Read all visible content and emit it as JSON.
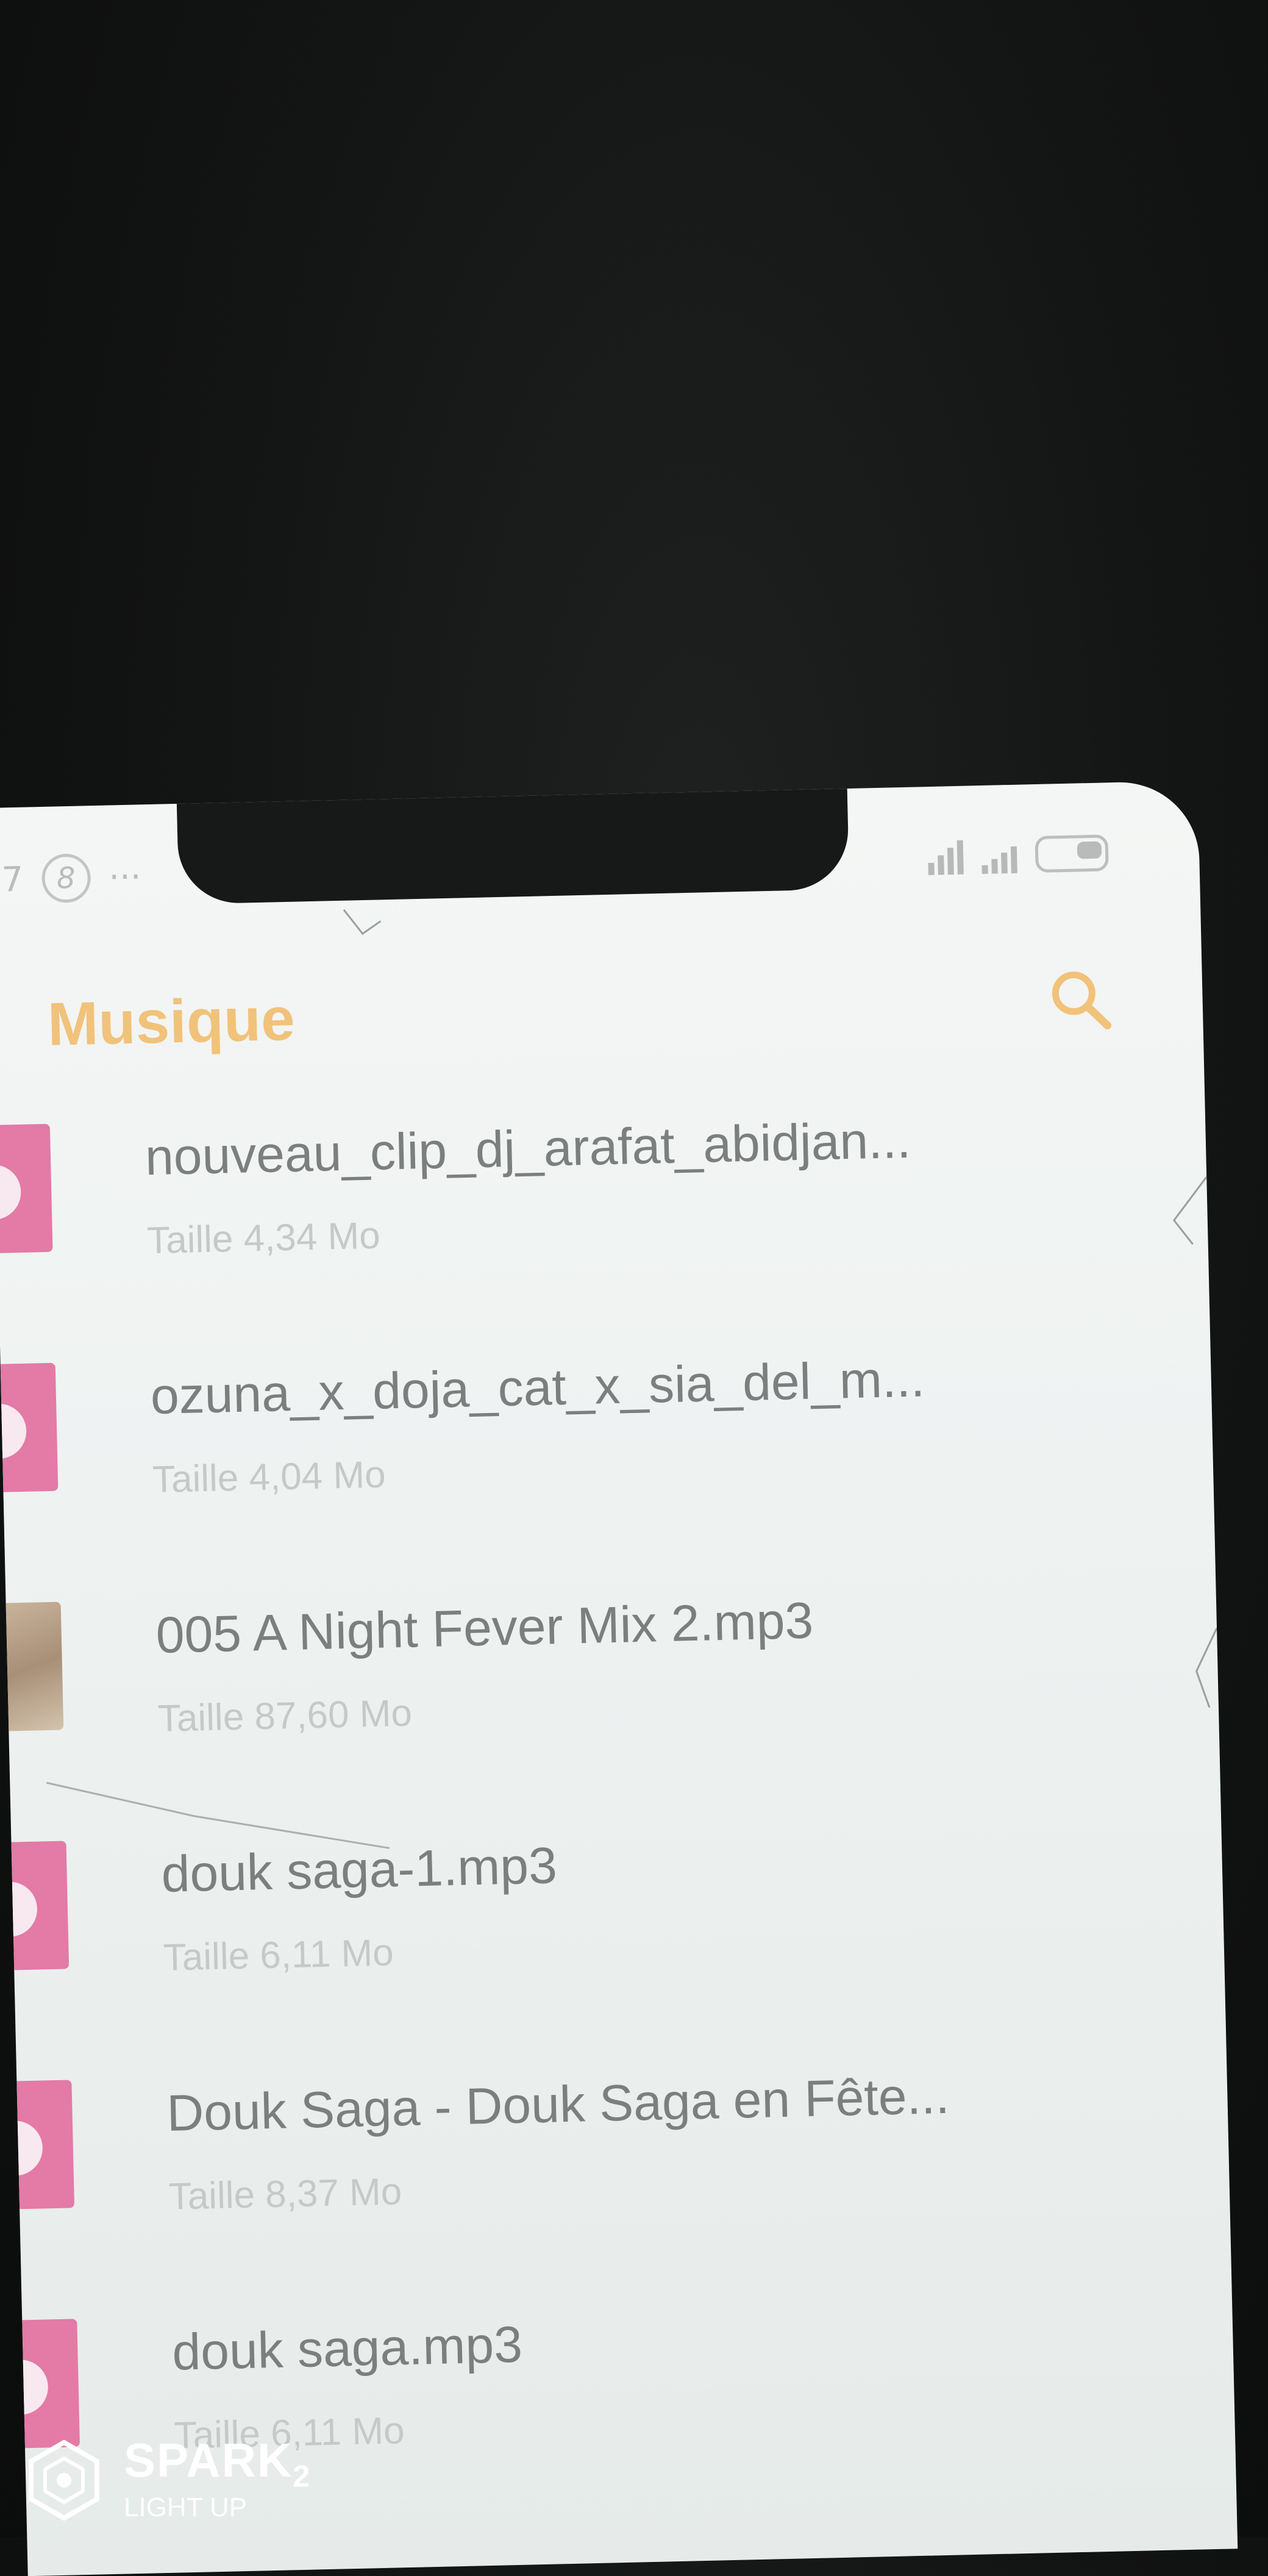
{
  "status_bar": {
    "left_number": "7",
    "badge": "8",
    "more": "···"
  },
  "header": {
    "title": "Musique",
    "search_icon": "search-icon",
    "accent_color": "#f1c27a"
  },
  "tracks": [
    {
      "name": "nouveau_clip_dj_arafat_abidjan...",
      "size": "Taille 4,34 Mo",
      "thumb": "pink-music"
    },
    {
      "name": "ozuna_x_doja_cat_x_sia_del_m...",
      "size": "Taille 4,04 Mo",
      "thumb": "pink-music"
    },
    {
      "name": "005 A Night Fever Mix 2.mp3",
      "size": "Taille 87,60 Mo",
      "thumb": "photo"
    },
    {
      "name": "douk saga-1.mp3",
      "size": "Taille 6,11 Mo",
      "thumb": "pink-music"
    },
    {
      "name": "Douk Saga - Douk Saga en Fête...",
      "size": "Taille 8,37 Mo",
      "thumb": "pink-music"
    },
    {
      "name": "douk saga.mp3",
      "size": "Taille 6,11 Mo",
      "thumb": "pink-music"
    }
  ],
  "watermark": {
    "brand": "SPARK",
    "model": "2",
    "tagline": "LIGHT UP"
  }
}
